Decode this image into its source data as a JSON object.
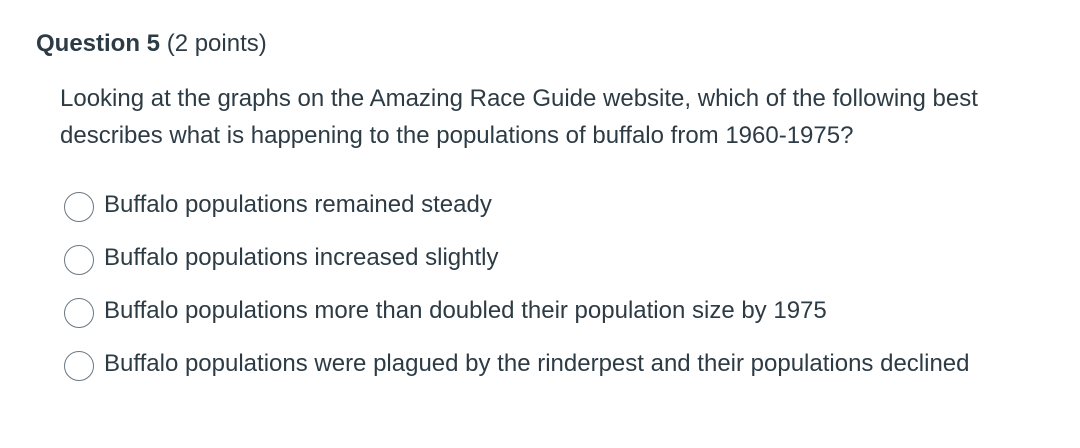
{
  "question": {
    "title": "Question 5",
    "points": "(2 points)",
    "text": "Looking at the graphs on the Amazing Race Guide website, which of the following best describes what is happening to the populations of buffalo from 1960-1975?",
    "options": [
      {
        "label": "Buffalo populations remained steady",
        "selected": false
      },
      {
        "label": "Buffalo populations increased slightly",
        "selected": false
      },
      {
        "label": "Buffalo populations more than doubled their population size by 1975",
        "selected": false
      },
      {
        "label": "Buffalo populations were plagued by the rinderpest and their populations declined",
        "selected": false
      }
    ]
  }
}
